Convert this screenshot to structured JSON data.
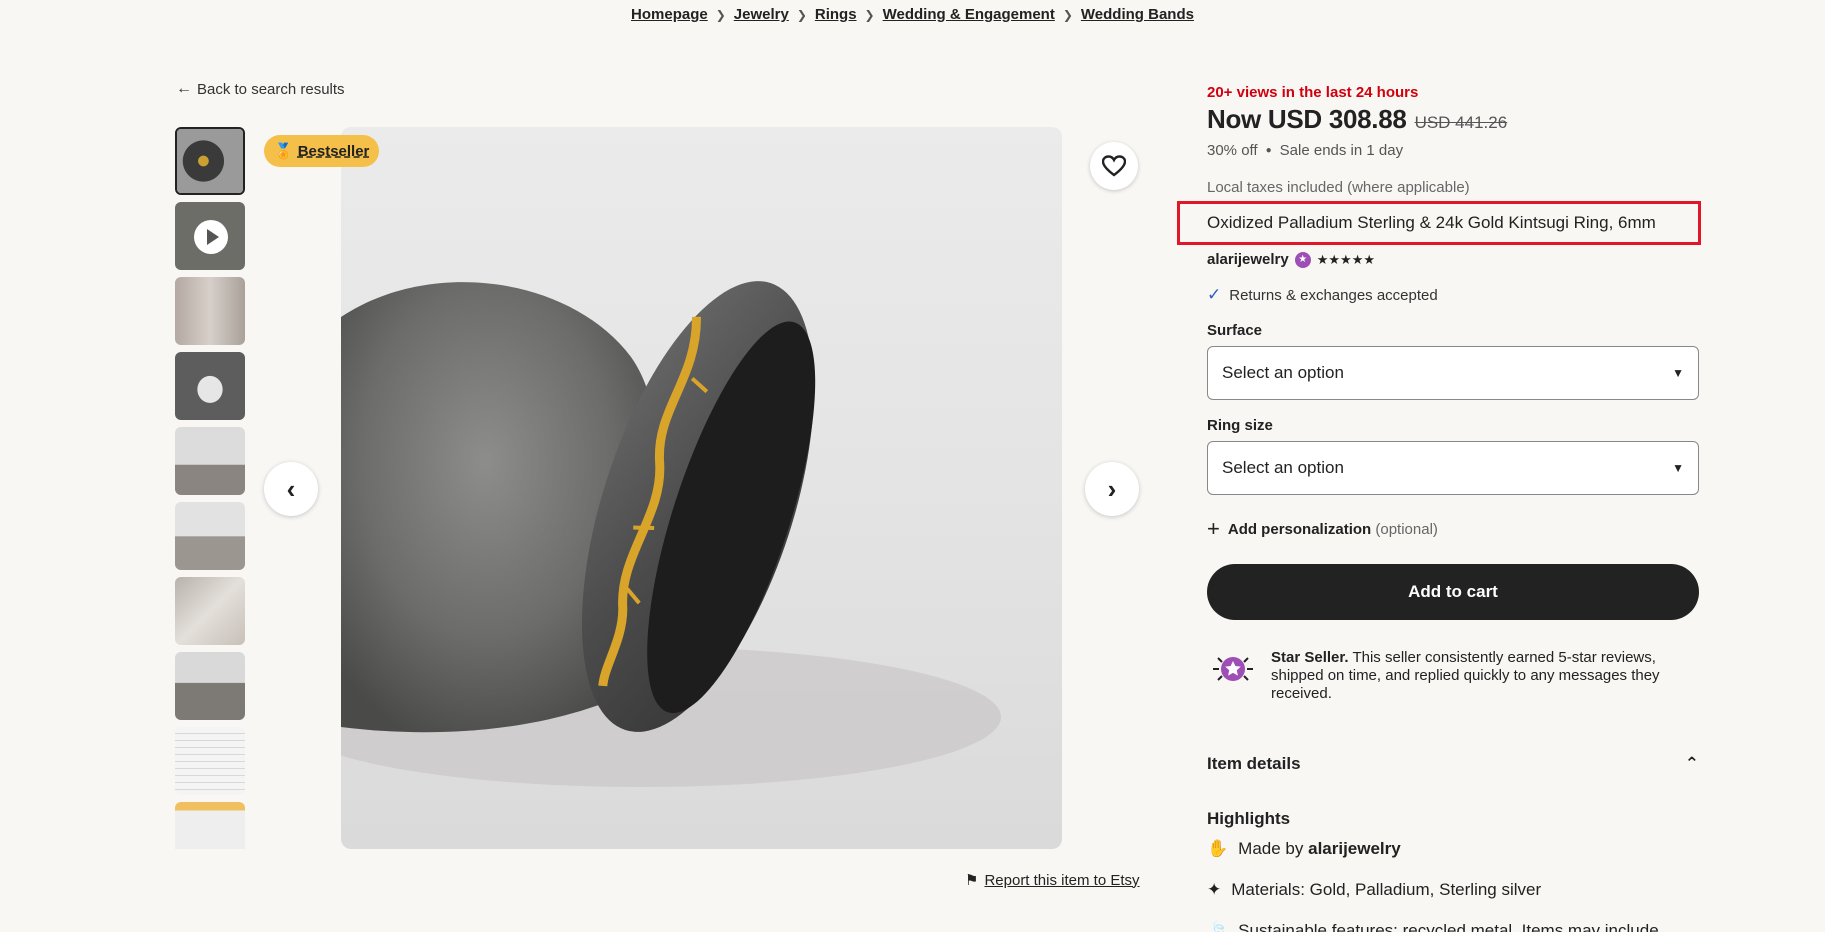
{
  "breadcrumb": [
    "Homepage",
    "Jewelry",
    "Rings",
    "Wedding & Engagement",
    "Wedding Bands"
  ],
  "back_link": "Back to search results",
  "badge": "Bestseller",
  "report_link": "Report this item to Etsy",
  "listing": {
    "views": "20+ views in the last 24 hours",
    "price_now": "Now USD 308.88",
    "price_old": "USD 441.26",
    "discount": "30% off",
    "sale_ends": "Sale ends in 1 day",
    "taxes": "Local taxes included (where applicable)",
    "title": "Oxidized Palladium Sterling & 24k Gold Kintsugi Ring, 6mm",
    "shop_name": "alarijewelry",
    "rating_stars": "★★★★★",
    "returns": "Returns & exchanges accepted",
    "surface_label": "Surface",
    "surface_value": "Select an option",
    "ring_size_label": "Ring size",
    "ring_size_value": "Select an option",
    "personalization": "Add personalization",
    "personalization_optional": "(optional)",
    "add_to_cart": "Add to cart",
    "star_seller_title": "Star Seller.",
    "star_seller_text": "This seller consistently earned 5-star reviews, shipped on time, and replied quickly to any messages they received.",
    "item_details": "Item details",
    "highlights_title": "Highlights",
    "made_by_prefix": "Made by",
    "made_by_shop": "alarijewelry",
    "materials": "Materials: Gold, Palladium, Sterling silver",
    "sustainable": "Sustainable features: recycled metal. Items may include"
  },
  "colors": {
    "accent_red": "#d1000f",
    "badge_yellow": "#f5c04a",
    "star_seller_purple": "#9d4fb5",
    "check_blue": "#2f5fc0",
    "button_dark": "#222222"
  }
}
